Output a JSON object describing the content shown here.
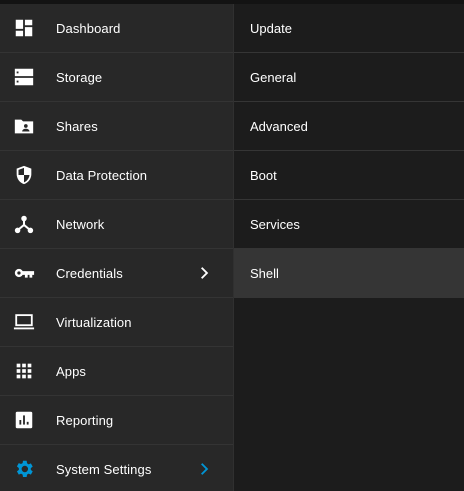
{
  "sidebar": {
    "items": [
      {
        "label": "Dashboard",
        "icon": "dashboard-icon"
      },
      {
        "label": "Storage",
        "icon": "storage-icon"
      },
      {
        "label": "Shares",
        "icon": "shares-folder-icon"
      },
      {
        "label": "Data Protection",
        "icon": "shield-icon"
      },
      {
        "label": "Network",
        "icon": "network-icon"
      },
      {
        "label": "Credentials",
        "icon": "key-icon",
        "has_submenu": true
      },
      {
        "label": "Virtualization",
        "icon": "laptop-icon"
      },
      {
        "label": "Apps",
        "icon": "apps-grid-icon"
      },
      {
        "label": "Reporting",
        "icon": "bar-chart-icon"
      },
      {
        "label": "System Settings",
        "icon": "gear-icon",
        "has_submenu": true,
        "active": true
      }
    ]
  },
  "submenu": {
    "items": [
      {
        "label": "Update"
      },
      {
        "label": "General"
      },
      {
        "label": "Advanced"
      },
      {
        "label": "Boot"
      },
      {
        "label": "Services"
      },
      {
        "label": "Shell",
        "highlighted": true
      }
    ]
  },
  "colors": {
    "accent": "#0095d5",
    "icon": "#ffffff",
    "sidebar_bg": "#282828",
    "submenu_bg": "#1c1c1c",
    "highlight_bg": "#353535"
  }
}
